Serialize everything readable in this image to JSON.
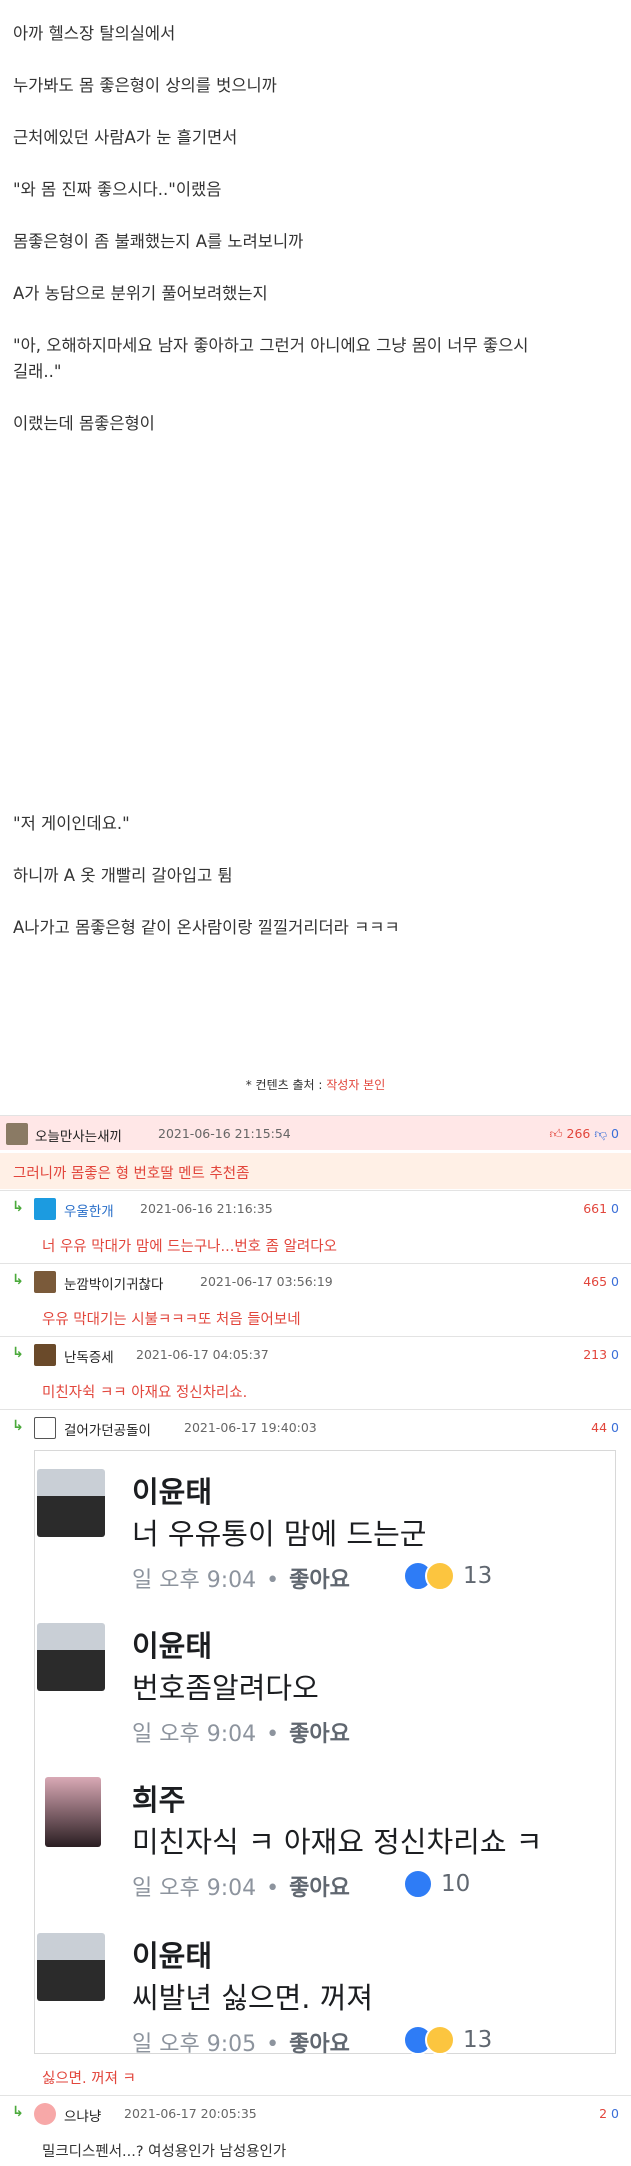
{
  "post": {
    "lines": [
      "아까 헬스장 탈의실에서",
      "누가봐도 몸 좋은형이 상의를 벗으니까",
      "근처에있던 사람A가 눈 흘기면서",
      "\"와 몸 진짜 좋으시다..\"이랬음",
      "몸좋은형이 좀 불쾌했는지 A를 노려보니까",
      "A가 농담으로 분위기 풀어보려했는지",
      "\"아, 오해하지마세요 남자 좋아하고 그런거 아니에요 그냥 몸이 너무 좋으시",
      "길래..\"",
      "이랬는데 몸좋은형이",
      "\"저 게이인데요.\"",
      "하니까 A 옷 개빨리 갈아입고 튐",
      "A나가고 몸좋은형 같이 온사람이랑 낄낄거리더라 ㅋㅋㅋ"
    ],
    "source_label": "* 컨텐츠 출처 : ",
    "source_value": "작성자 본인"
  },
  "comments": [
    {
      "nick": "오늘만사는새끼",
      "date": "2021-06-16 21:15:54",
      "up": "266",
      "down": "0",
      "text": "그러니까 몸좋은 형 번호딸 멘트 추천좀"
    },
    {
      "nick": "우울한개",
      "date": "2021-06-16 21:16:35",
      "up": "661",
      "down": "0",
      "text": "너 우유 막대가 맘에 드는구나...번호 좀 알려다오"
    },
    {
      "nick": "눈깜박이기귀찮다",
      "date": "2021-06-17 03:56:19",
      "up": "465",
      "down": "0",
      "text": "우유 막대기는 시불ㅋㅋㅋ또 처음 들어보네"
    },
    {
      "nick": "난독증세",
      "date": "2021-06-17 04:05:37",
      "up": "213",
      "down": "0",
      "text": "미친자쉭 ㅋㅋ 아재요 정신차리쇼."
    },
    {
      "nick": "걸어가던공돌이",
      "date": "2021-06-17 19:40:03",
      "up": "44",
      "down": "0",
      "text": "싫으면. 꺼져 ㅋ"
    },
    {
      "nick": "으냐냥",
      "date": "2021-06-17 20:05:35",
      "up": "2",
      "down": "0",
      "text": "밀크디스펜서...? 여성용인가 남성용인가"
    }
  ],
  "embed": {
    "items": [
      {
        "name": "이윤태",
        "msg": "너 우유통이 맘에 드는군",
        "time": "일 오후 9:04",
        "like": "좋아요",
        "count": "13"
      },
      {
        "name": "이윤태",
        "msg": "번호좀알려다오",
        "time": "일 오후 9:04",
        "like": "좋아요",
        "count": ""
      },
      {
        "name": "희주",
        "msg": "미친자식 ㅋ 아재요 정신차리쇼 ㅋ",
        "time": "일 오후 9:04",
        "like": "좋아요",
        "count": "10"
      },
      {
        "name": "이윤태",
        "msg": "씨발년 싫으면. 꺼져",
        "time": "일 오후 9:05",
        "like": "좋아요",
        "count": "13"
      }
    ],
    "dot": "•"
  },
  "colors": {
    "accent": "#e2463c",
    "reply": "#4caa3c",
    "downvote": "#3b6fd8"
  }
}
